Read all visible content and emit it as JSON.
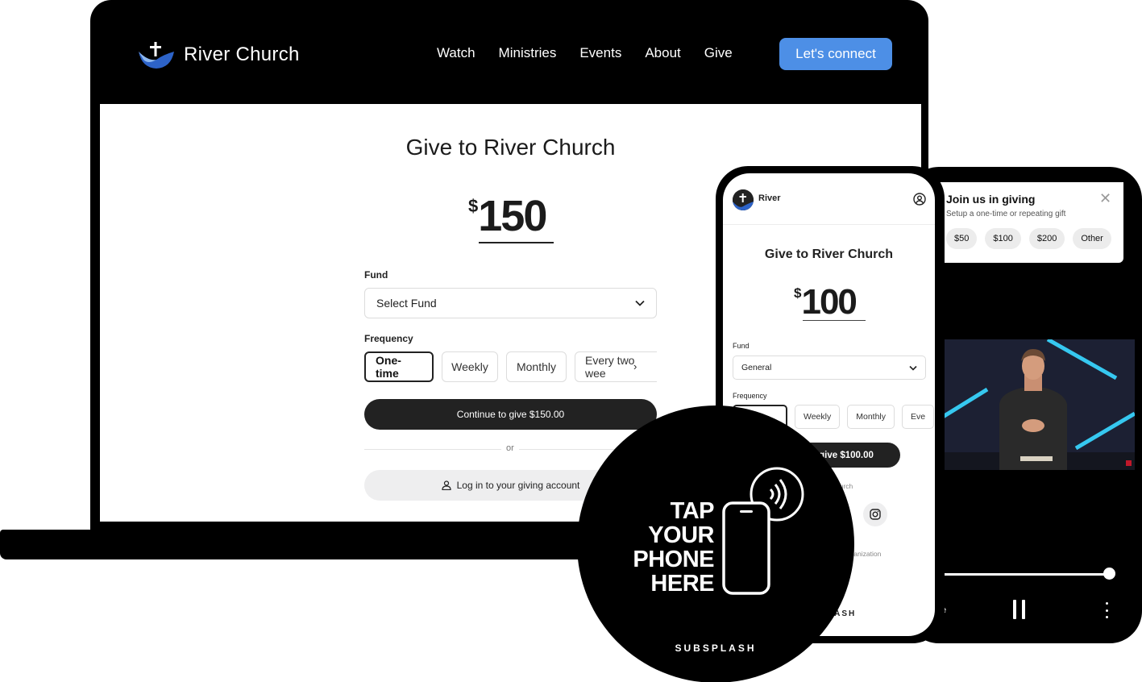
{
  "site": {
    "brand": "River Church",
    "nav": [
      "Watch",
      "Ministries",
      "Events",
      "About",
      "Give"
    ],
    "connect_label": "Let's connect"
  },
  "desktop_form": {
    "title": "Give to River Church",
    "currency_symbol": "$",
    "amount": "150",
    "fund_label": "Fund",
    "fund_value": "Select Fund",
    "frequency_label": "Frequency",
    "frequencies": [
      "One-time",
      "Weekly",
      "Monthly",
      "Every two wee"
    ],
    "selected_frequency": "One-time",
    "continue_label": "Continue to give $150.00",
    "or_label": "or",
    "login_label": "Log in to your giving account"
  },
  "phone_form": {
    "brand": "River",
    "title": "Give to River Church",
    "currency_symbol": "$",
    "amount": "100",
    "fund_label": "Fund",
    "fund_value": "General",
    "frequency_label": "Frequency",
    "frequencies": [
      "",
      "Weekly",
      "Monthly",
      "Eve"
    ],
    "give_label": "to give $100.00",
    "church_fragment": "hurch",
    "org_fragment": "organization",
    "subsplash_fragment": "LASH"
  },
  "giving_card": {
    "title": "Join us in giving",
    "subtitle": "Setup a one-time or repeating gift",
    "amounts": [
      "$50",
      "$100",
      "$200",
      "Other"
    ]
  },
  "player": {
    "left_fragment": "e",
    "progress": 0.97
  },
  "nfc": {
    "lines": [
      "TAP",
      "YOUR",
      "PHONE",
      "HERE"
    ],
    "brand": "SUBSPLASH"
  },
  "colors": {
    "accent": "#4d8fe6",
    "dark": "#222222",
    "video_accent": "#36c8f0"
  }
}
